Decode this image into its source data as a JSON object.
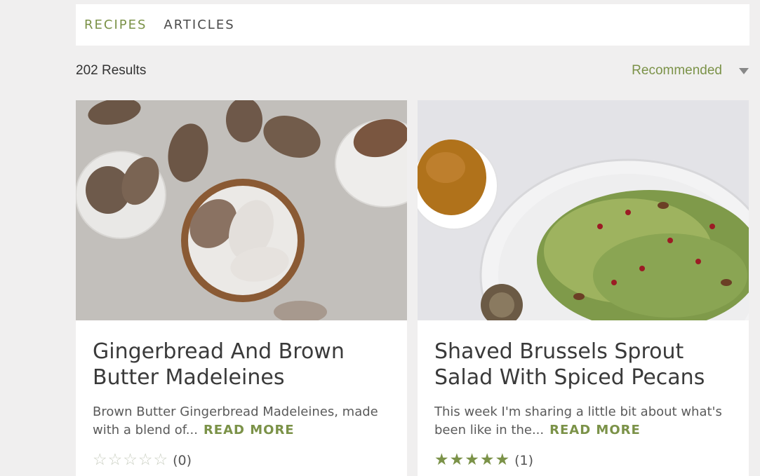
{
  "tabs": [
    {
      "label": "RECIPES",
      "active": true
    },
    {
      "label": "ARTICLES",
      "active": false
    }
  ],
  "results": {
    "count_text": "202 Results"
  },
  "sort": {
    "label": "Recommended"
  },
  "colors": {
    "accent": "#7b9248",
    "background": "#f0efef"
  },
  "cards": [
    {
      "title": "Gingerbread And Brown Butter Madeleines",
      "description": "Brown Butter Gingerbread Madeleines, made with a blend of...",
      "read_more": "READ MORE",
      "rating_stars": 0,
      "rating_count": "(0)"
    },
    {
      "title": "Shaved Brussels Sprout Salad With Spiced Pecans",
      "description": "This week I'm sharing a little bit about what's been like in the...",
      "read_more": "READ MORE",
      "rating_stars": 5,
      "rating_count": "(1)"
    }
  ]
}
